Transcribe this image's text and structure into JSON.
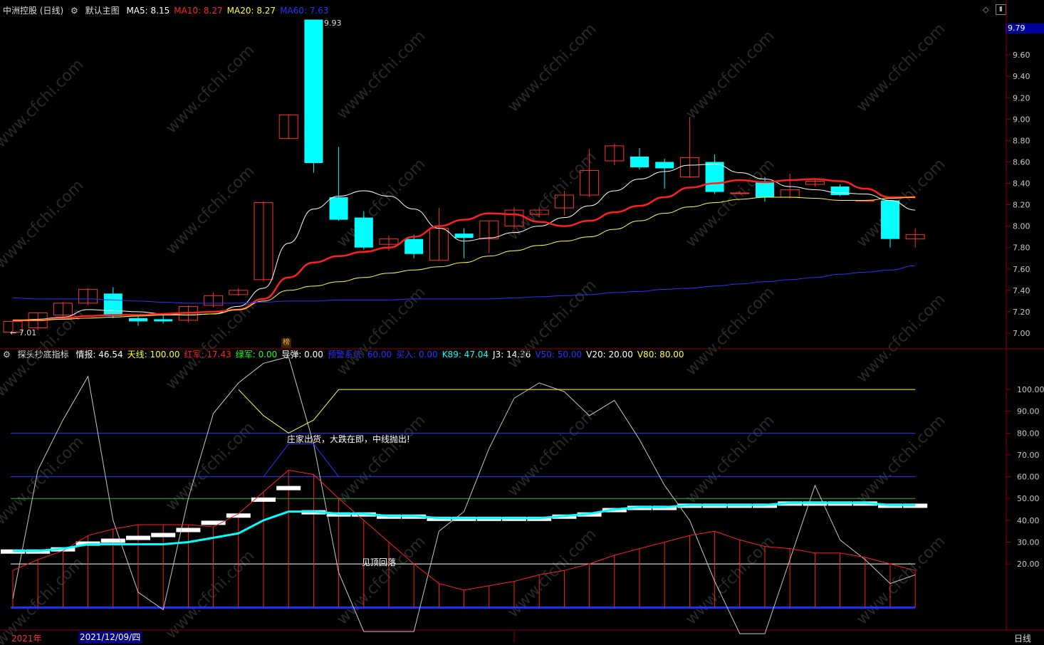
{
  "window": {
    "stock_title": "中洲控股 (日线)",
    "theme_label": "默认主图",
    "ma_labels": [
      {
        "text": "MA5: 8.15",
        "color": "#ffffff"
      },
      {
        "text": "MA10: 8.27",
        "color": "#ff2020"
      },
      {
        "text": "MA20: 8.27",
        "color": "#ffff40"
      },
      {
        "text": "MA60: 7.63",
        "color": "#3030ff"
      }
    ],
    "current_price_tag": "9.79",
    "high_label": "9.93",
    "low_label": "7.01",
    "bang_badge": "榜",
    "period_label": "日线",
    "year_label": "2021年",
    "date_cursor": "2021/12/09/四"
  },
  "indicator": {
    "name": "探头抄底指标",
    "labels": [
      {
        "text": "情报: 46.54",
        "color": "#ffffff"
      },
      {
        "text": "天线: 100.00",
        "color": "#ffff40"
      },
      {
        "text": "红军: 17.43",
        "color": "#ff2020"
      },
      {
        "text": "绿军: 0.00",
        "color": "#20ff20"
      },
      {
        "text": "导弹: 0.00",
        "color": "#ffffff"
      },
      {
        "text": "预警系统: 60.00",
        "color": "#3030ff"
      },
      {
        "text": "买入: 0.00",
        "color": "#3030ff"
      },
      {
        "text": "K89: 47.04",
        "color": "#00ffff"
      },
      {
        "text": "J3: 14.36",
        "color": "#ffffff"
      },
      {
        "text": "V50: 50.00",
        "color": "#3030ff"
      },
      {
        "text": "V20: 20.00",
        "color": "#ffffff"
      },
      {
        "text": "V80: 80.00",
        "color": "#ffff40"
      }
    ],
    "annotation_top": "庄家出货，大跌在即，中线抛出!",
    "annotation_bottom": "见顶回落"
  },
  "watermark": "www.cfchi.com",
  "chart_data": [
    {
      "type": "candlestick",
      "title": "中洲控股 (日线)",
      "ylim": [
        6.88,
        9.98
      ],
      "y_ticks": [
        7.0,
        7.2,
        7.4,
        7.6,
        7.8,
        8.0,
        8.2,
        8.4,
        8.6,
        8.8,
        9.0,
        9.2,
        9.4,
        9.6
      ],
      "candles": [
        {
          "o": 7.01,
          "h": 7.12,
          "l": 7.01,
          "c": 7.11
        },
        {
          "o": 7.05,
          "h": 7.19,
          "l": 7.03,
          "c": 7.19
        },
        {
          "o": 7.17,
          "h": 7.29,
          "l": 7.15,
          "c": 7.28
        },
        {
          "o": 7.28,
          "h": 7.42,
          "l": 7.26,
          "c": 7.41
        },
        {
          "o": 7.37,
          "h": 7.43,
          "l": 7.14,
          "c": 7.16
        },
        {
          "o": 7.14,
          "h": 7.17,
          "l": 7.07,
          "c": 7.11
        },
        {
          "o": 7.13,
          "h": 7.17,
          "l": 7.09,
          "c": 7.11
        },
        {
          "o": 7.12,
          "h": 7.26,
          "l": 7.1,
          "c": 7.25
        },
        {
          "o": 7.26,
          "h": 7.38,
          "l": 7.24,
          "c": 7.35
        },
        {
          "o": 7.36,
          "h": 7.42,
          "l": 7.35,
          "c": 7.4
        },
        {
          "o": 7.5,
          "h": 8.23,
          "l": 7.48,
          "c": 8.22
        },
        {
          "o": 8.82,
          "h": 9.04,
          "l": 8.82,
          "c": 9.04
        },
        {
          "o": 9.93,
          "h": 9.93,
          "l": 8.5,
          "c": 8.59
        },
        {
          "o": 8.27,
          "h": 8.74,
          "l": 8.05,
          "c": 8.06
        },
        {
          "o": 8.08,
          "h": 8.14,
          "l": 7.78,
          "c": 7.8
        },
        {
          "o": 7.83,
          "h": 7.91,
          "l": 7.77,
          "c": 7.88
        },
        {
          "o": 7.88,
          "h": 7.92,
          "l": 7.7,
          "c": 7.74
        },
        {
          "o": 7.68,
          "h": 8.17,
          "l": 7.68,
          "c": 7.98
        },
        {
          "o": 7.93,
          "h": 7.98,
          "l": 7.7,
          "c": 7.89
        },
        {
          "o": 7.88,
          "h": 8.05,
          "l": 7.75,
          "c": 8.05
        },
        {
          "o": 8.0,
          "h": 8.18,
          "l": 7.97,
          "c": 8.15
        },
        {
          "o": 8.11,
          "h": 8.18,
          "l": 8.08,
          "c": 8.15
        },
        {
          "o": 8.17,
          "h": 8.33,
          "l": 8.1,
          "c": 8.29
        },
        {
          "o": 8.29,
          "h": 8.72,
          "l": 8.27,
          "c": 8.52
        },
        {
          "o": 8.61,
          "h": 8.77,
          "l": 8.57,
          "c": 8.75
        },
        {
          "o": 8.65,
          "h": 8.73,
          "l": 8.53,
          "c": 8.55
        },
        {
          "o": 8.6,
          "h": 8.63,
          "l": 8.35,
          "c": 8.54
        },
        {
          "o": 8.46,
          "h": 9.02,
          "l": 8.45,
          "c": 8.64
        },
        {
          "o": 8.6,
          "h": 8.67,
          "l": 8.3,
          "c": 8.32
        },
        {
          "o": 8.31,
          "h": 8.33,
          "l": 8.31,
          "c": 8.31
        },
        {
          "o": 8.42,
          "h": 8.46,
          "l": 8.23,
          "c": 8.27
        },
        {
          "o": 8.27,
          "h": 8.49,
          "l": 8.26,
          "c": 8.34
        },
        {
          "o": 8.39,
          "h": 8.44,
          "l": 8.37,
          "c": 8.42
        },
        {
          "o": 8.37,
          "h": 8.39,
          "l": 8.28,
          "c": 8.29
        },
        {
          "o": 8.24,
          "h": 8.24,
          "l": 8.24,
          "c": 8.24
        },
        {
          "o": 8.24,
          "h": 8.24,
          "l": 7.8,
          "c": 7.88
        },
        {
          "o": 7.88,
          "h": 7.98,
          "l": 7.8,
          "c": 7.92
        }
      ],
      "series": [
        {
          "name": "MA5",
          "color": "#ffffff",
          "values": [
            7.12,
            7.13,
            7.15,
            7.22,
            7.21,
            7.2,
            7.18,
            7.17,
            7.18,
            7.25,
            7.42,
            7.84,
            8.16,
            8.28,
            8.33,
            8.28,
            8.16,
            7.98,
            7.86,
            7.89,
            7.94,
            8.0,
            8.08,
            8.19,
            8.33,
            8.44,
            8.51,
            8.57,
            8.58,
            8.5,
            8.44,
            8.37,
            8.34,
            8.31,
            8.3,
            8.24,
            8.15
          ]
        },
        {
          "name": "MA10",
          "color": "#ff2020",
          "values": [
            7.12,
            7.12,
            7.14,
            7.16,
            7.17,
            7.17,
            7.18,
            7.19,
            7.2,
            7.22,
            7.32,
            7.52,
            7.66,
            7.72,
            7.76,
            7.8,
            7.9,
            8.0,
            8.06,
            8.12,
            8.11,
            8.04,
            8.0,
            8.05,
            8.13,
            8.19,
            8.27,
            8.36,
            8.4,
            8.43,
            8.41,
            8.43,
            8.44,
            8.42,
            8.35,
            8.27,
            8.27
          ]
        },
        {
          "name": "MA20",
          "color": "#ffff40",
          "values": [
            7.12,
            7.12,
            7.13,
            7.14,
            7.15,
            7.16,
            7.17,
            7.17,
            7.18,
            7.22,
            7.3,
            7.4,
            7.44,
            7.48,
            7.52,
            7.56,
            7.59,
            7.62,
            7.66,
            7.72,
            7.77,
            7.82,
            7.86,
            7.9,
            7.97,
            8.05,
            8.12,
            8.18,
            8.22,
            8.25,
            8.27,
            8.27,
            8.26,
            8.24,
            8.24,
            8.26,
            8.27
          ]
        },
        {
          "name": "MA60",
          "color": "#3030ff",
          "values": [
            7.33,
            7.32,
            7.32,
            7.32,
            7.31,
            7.3,
            7.29,
            7.28,
            7.28,
            7.28,
            7.29,
            7.3,
            7.3,
            7.31,
            7.31,
            7.31,
            7.32,
            7.32,
            7.32,
            7.32,
            7.33,
            7.34,
            7.35,
            7.36,
            7.38,
            7.39,
            7.41,
            7.42,
            7.44,
            7.46,
            7.48,
            7.5,
            7.52,
            7.55,
            7.57,
            7.59,
            7.63
          ]
        }
      ]
    },
    {
      "type": "line",
      "title": "探头抄底指标",
      "ylim": [
        -10,
        117
      ],
      "y_ticks": [
        20,
        30,
        40,
        50,
        60,
        70,
        80,
        90,
        100
      ],
      "reference_lines": [
        {
          "name": "V20",
          "value": 20,
          "color": "#ffffff"
        },
        {
          "name": "V50",
          "value": 50,
          "color": "#20c020"
        },
        {
          "name": "预警系统",
          "value": 60,
          "color": "#3030ff"
        },
        {
          "name": "V80",
          "value": 80,
          "color": "#3030ff"
        },
        {
          "name": "天线",
          "value": 100,
          "color": "#ffff40"
        }
      ],
      "series": [
        {
          "name": "情报",
          "color": "#c8c8c8",
          "values": [
            4,
            63,
            86,
            106,
            40,
            7,
            -1,
            50,
            89,
            103,
            112,
            115,
            75,
            16,
            -11,
            -11,
            -11,
            35,
            44,
            73,
            96,
            103,
            99,
            88,
            95,
            77,
            56,
            40,
            12,
            -12,
            -12,
            22,
            56,
            31,
            22,
            11,
            15
          ]
        },
        {
          "name": "红军",
          "color": "#ff2020",
          "values": [
            17,
            22,
            26,
            33,
            36,
            38,
            38,
            38,
            37,
            43,
            53,
            63,
            61,
            50,
            40,
            30,
            20,
            11,
            8,
            10,
            12,
            15,
            17,
            20,
            24,
            27,
            30,
            33,
            35,
            31,
            28,
            27,
            25,
            25,
            23,
            20,
            17
          ]
        },
        {
          "name": "K89",
          "color": "#00ffff",
          "values": [
            26,
            26,
            27,
            29,
            29,
            29,
            29,
            30,
            32,
            34,
            40,
            44,
            44,
            43,
            43,
            42,
            42,
            41,
            41,
            41,
            41,
            41,
            42,
            43,
            45,
            46,
            46,
            47,
            47,
            47,
            47,
            48,
            48,
            48,
            48,
            47,
            47
          ]
        },
        {
          "name": "天线",
          "color": "#ffff40",
          "values": [
            null,
            null,
            null,
            null,
            null,
            null,
            null,
            null,
            null,
            100,
            88,
            80,
            86,
            100,
            100,
            100,
            100,
            100,
            100,
            100,
            100,
            100,
            100,
            100,
            100,
            100,
            100,
            100,
            100,
            100,
            100,
            100,
            100,
            100,
            100,
            100,
            100
          ]
        },
        {
          "name": "预警系统",
          "color": "#3030ff",
          "values": [
            null,
            null,
            null,
            null,
            null,
            null,
            null,
            null,
            null,
            null,
            60,
            75,
            75,
            60,
            null,
            null,
            null,
            null,
            null,
            null,
            null,
            null,
            null,
            null,
            null,
            null,
            null,
            null,
            null,
            null,
            null,
            null,
            null,
            null,
            null,
            null,
            null
          ]
        }
      ]
    }
  ]
}
